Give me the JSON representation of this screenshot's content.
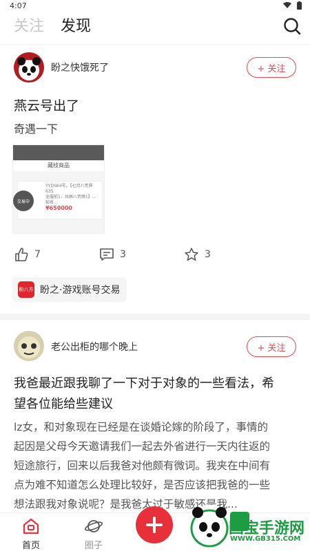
{
  "status": {
    "time": "4:07"
  },
  "tabs": {
    "follow": "关注",
    "discover": "发现"
  },
  "post1": {
    "username": "盼之快饿死了",
    "follow_label": "+ 关注",
    "title": "燕云号出了",
    "body": "奇遇一下",
    "thumb": {
      "header": "藏枝商品",
      "card_lines": [
        "YYDSK4号。【七月八荒界635",
        "全服前1，共屏八荒榜1】...知名..."
      ],
      "price": "¥650000",
      "circle_label": "交易中"
    },
    "likes": "7",
    "comments": "3",
    "favorites": "3",
    "tag": "盼之·游戏账号交易",
    "tag_logo": "盼八方"
  },
  "post2": {
    "username": "老公出柜的哪个晚上",
    "follow_label": "+ 关注",
    "title_line1": "我爸最近跟我聊了一下对于对象的一些看法，希",
    "title_line2": "望各位能给些建议",
    "body_lines": [
      "lz女，和对象现在已经是在谈婚论嫁的阶段了，事情的",
      "起因是父母今天邀请我们一起去外省进行一天内往返的",
      "短途旅行，回来以后我爸对他颇有微词。我夹在中间有",
      "点为难不知道怎么处理比较好，是否应该把我爸的一些",
      "想法跟我对象说呢？是我爸太过于敏感还是我..."
    ]
  },
  "nav": {
    "home": "首页",
    "circle": "圈子"
  },
  "watermark": {
    "brand": "国宝手游网",
    "url": "WWW.GB315.COM"
  },
  "colors": {
    "accent": "#e8464b",
    "fab": "#e8303a"
  }
}
